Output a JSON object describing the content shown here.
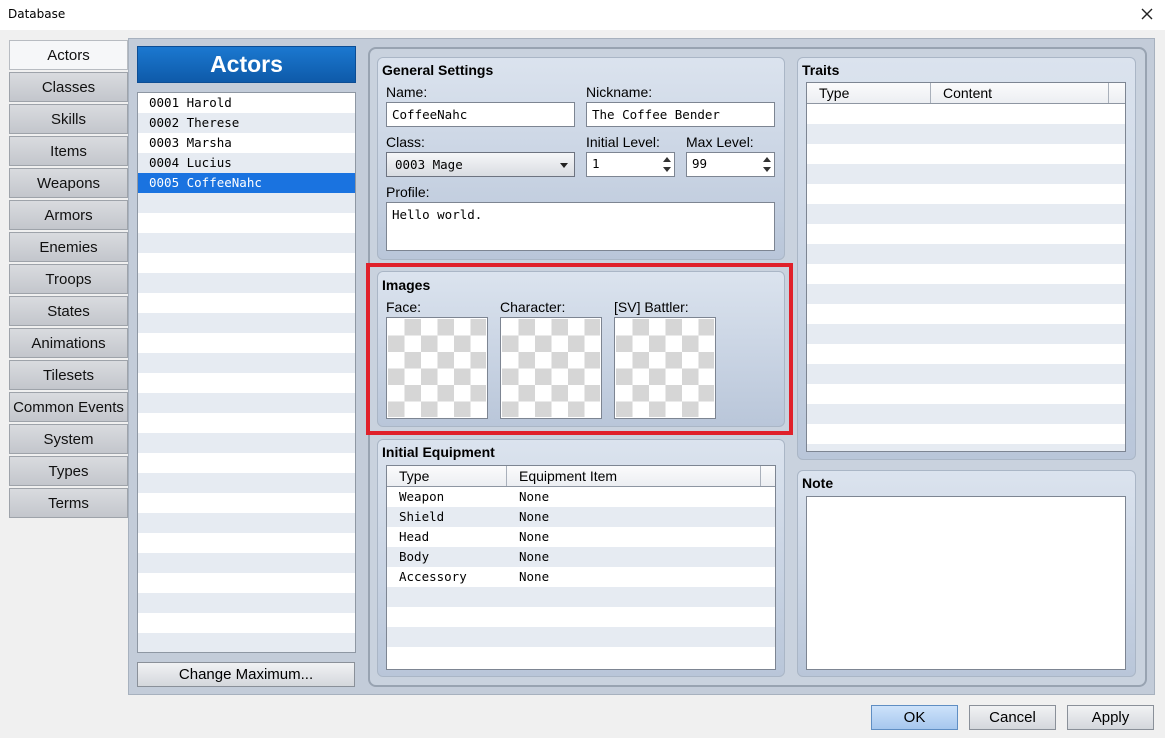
{
  "window": {
    "title": "Database"
  },
  "tabs": [
    "Actors",
    "Classes",
    "Skills",
    "Items",
    "Weapons",
    "Armors",
    "Enemies",
    "Troops",
    "States",
    "Animations",
    "Tilesets",
    "Common Events",
    "System",
    "Types",
    "Terms"
  ],
  "active_tab": "Actors",
  "actor_panel": {
    "header": "Actors",
    "items": [
      "0001 Harold",
      "0002 Therese",
      "0003 Marsha",
      "0004 Lucius",
      "0005 CoffeeNahc"
    ],
    "selected": "0005 CoffeeNahc",
    "change_max_label": "Change Maximum..."
  },
  "general": {
    "title": "General Settings",
    "name_label": "Name:",
    "name_value": "CoffeeNahc",
    "nickname_label": "Nickname:",
    "nickname_value": "The Coffee Bender",
    "class_label": "Class:",
    "class_value": "0003 Mage",
    "initial_level_label": "Initial Level:",
    "initial_level_value": "1",
    "max_level_label": "Max Level:",
    "max_level_value": "99",
    "profile_label": "Profile:",
    "profile_value": "Hello world."
  },
  "images": {
    "title": "Images",
    "face_label": "Face:",
    "character_label": "Character:",
    "battler_label": "[SV] Battler:"
  },
  "equipment": {
    "title": "Initial Equipment",
    "headers": [
      "Type",
      "Equipment Item"
    ],
    "rows": [
      [
        "Weapon",
        "None"
      ],
      [
        "Shield",
        "None"
      ],
      [
        "Head",
        "None"
      ],
      [
        "Body",
        "None"
      ],
      [
        "Accessory",
        "None"
      ]
    ]
  },
  "traits": {
    "title": "Traits",
    "headers": [
      "Type",
      "Content"
    ]
  },
  "note": {
    "title": "Note"
  },
  "buttons": {
    "ok": "OK",
    "cancel": "Cancel",
    "apply": "Apply"
  },
  "colors": {
    "selection": "#1a73e0",
    "header_blue": "#1568be",
    "highlight_red": "#e0202a"
  }
}
